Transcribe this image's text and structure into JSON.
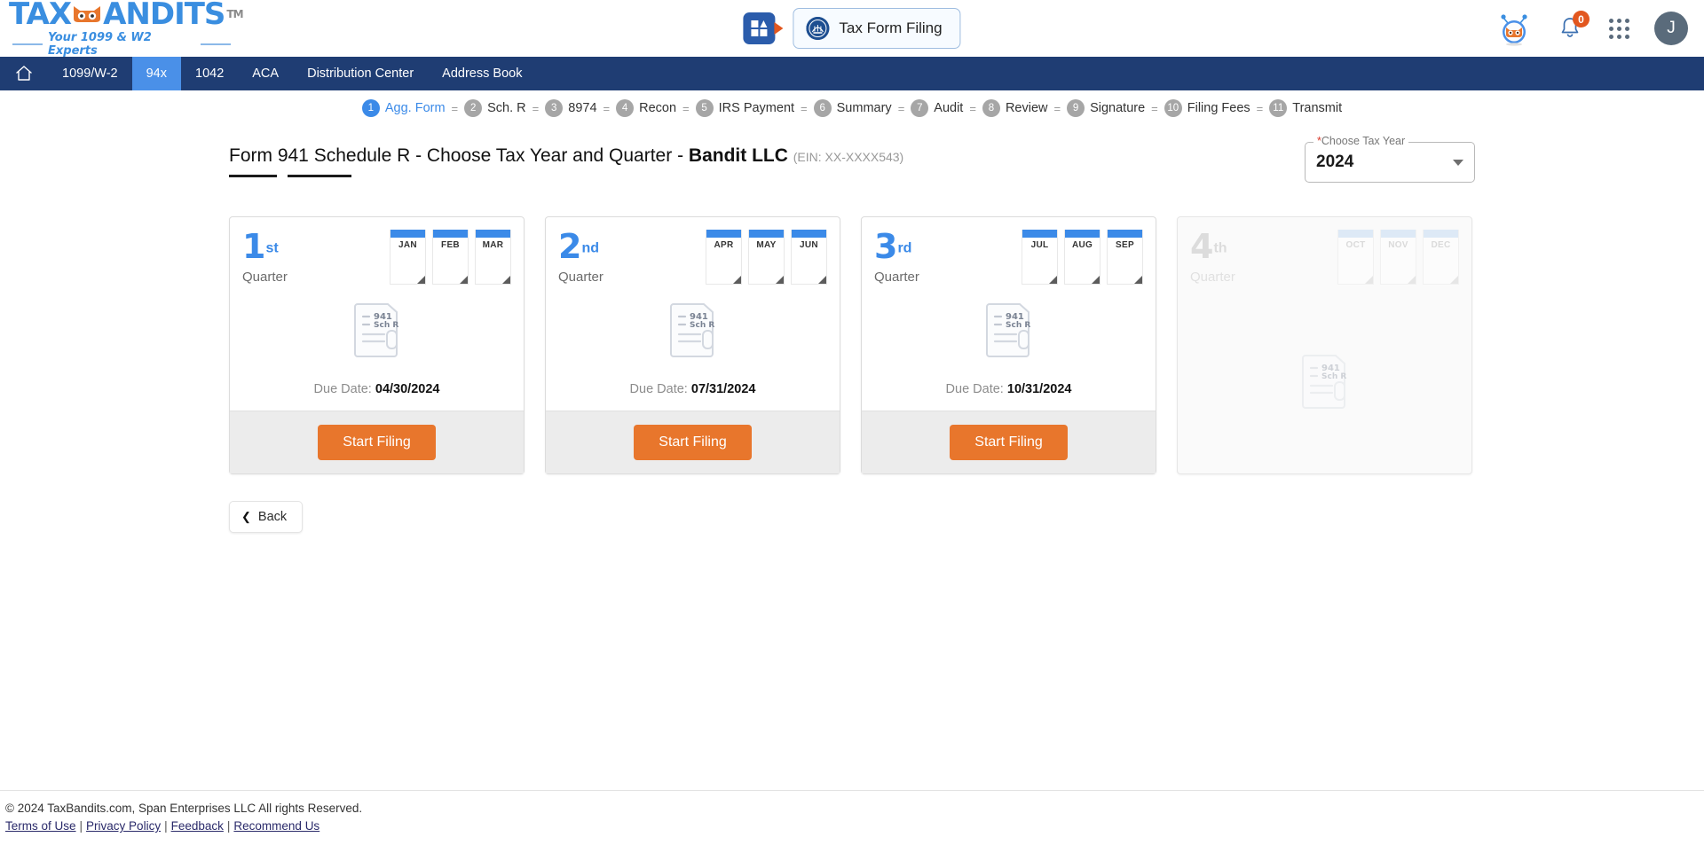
{
  "brand": {
    "logo_main_1": "TAX",
    "logo_main_2": "ANDITS",
    "logo_tm": "TM",
    "logo_tagline": "Your 1099 & W2 Experts"
  },
  "header": {
    "app_icon": "dashboard-grid-icon",
    "tax_form_filing_label": "Tax Form Filing",
    "seal_icon": "irs-seal-icon",
    "mascot_icon": "bandit-mascot-icon",
    "bell_icon": "notification-bell-icon",
    "bell_count": "0",
    "apps_icon": "apps-grid-icon",
    "avatar_initial": "J"
  },
  "nav": {
    "home_icon": "home-icon",
    "items": [
      {
        "label": "1099/W-2",
        "active": false
      },
      {
        "label": "94x",
        "active": true
      },
      {
        "label": "1042",
        "active": false
      },
      {
        "label": "ACA",
        "active": false
      },
      {
        "label": "Distribution Center",
        "active": false
      },
      {
        "label": "Address Book",
        "active": false
      }
    ]
  },
  "stepper": {
    "separator": "=",
    "steps": [
      {
        "num": "1",
        "label": "Agg. Form",
        "active": true
      },
      {
        "num": "2",
        "label": "Sch. R",
        "active": false
      },
      {
        "num": "3",
        "label": "8974",
        "active": false
      },
      {
        "num": "4",
        "label": "Recon",
        "active": false
      },
      {
        "num": "5",
        "label": "IRS Payment",
        "active": false
      },
      {
        "num": "6",
        "label": "Summary",
        "active": false
      },
      {
        "num": "7",
        "label": "Audit",
        "active": false
      },
      {
        "num": "8",
        "label": "Review",
        "active": false
      },
      {
        "num": "9",
        "label": "Signature",
        "active": false
      },
      {
        "num": "10",
        "label": "Filing Fees",
        "active": false
      },
      {
        "num": "11",
        "label": "Transmit",
        "active": false
      }
    ]
  },
  "page": {
    "title": "Form 941 Schedule R - Choose Tax Year and Quarter",
    "company_prefix": " - ",
    "company": "Bandit LLC",
    "ein": "(EIN: XX-XXXX543)"
  },
  "tax_year_select": {
    "label_required": "*",
    "label": "Choose Tax Year",
    "value": "2024",
    "chevron_icon": "chevron-down-icon"
  },
  "quarters": [
    {
      "num": "1",
      "sup": "st",
      "word": "Quarter",
      "months": [
        "JAN",
        "FEB",
        "MAR"
      ],
      "doc_line1": "941",
      "doc_line2": "Sch R",
      "due_label": "Due Date:",
      "due_date": "04/30/2024",
      "button": "Start Filing",
      "disabled": false
    },
    {
      "num": "2",
      "sup": "nd",
      "word": "Quarter",
      "months": [
        "APR",
        "MAY",
        "JUN"
      ],
      "doc_line1": "941",
      "doc_line2": "Sch R",
      "due_label": "Due Date:",
      "due_date": "07/31/2024",
      "button": "Start Filing",
      "disabled": false
    },
    {
      "num": "3",
      "sup": "rd",
      "word": "Quarter",
      "months": [
        "JUL",
        "AUG",
        "SEP"
      ],
      "doc_line1": "941",
      "doc_line2": "Sch R",
      "due_label": "Due Date:",
      "due_date": "10/31/2024",
      "button": "Start Filing",
      "disabled": false
    },
    {
      "num": "4",
      "sup": "th",
      "word": "Quarter",
      "months": [
        "OCT",
        "NOV",
        "DEC"
      ],
      "doc_line1": "941",
      "doc_line2": "Sch R",
      "due_label": "",
      "due_date": "",
      "button": "",
      "disabled": true
    }
  ],
  "back_button": {
    "label": "Back",
    "icon": "chevron-left-icon"
  },
  "footer": {
    "copyright": "© 2024 TaxBandits.com, Span Enterprises LLC All rights Reserved.",
    "links": [
      "Terms of Use",
      "Privacy Policy",
      "Feedback",
      "Recommend Us"
    ],
    "separator": "|"
  },
  "colors": {
    "brand_blue": "#3a8ee0",
    "nav_blue": "#1f3d73",
    "nav_active": "#4a90e8",
    "accent_orange": "#e8762c",
    "badge_orange": "#e2571f"
  }
}
